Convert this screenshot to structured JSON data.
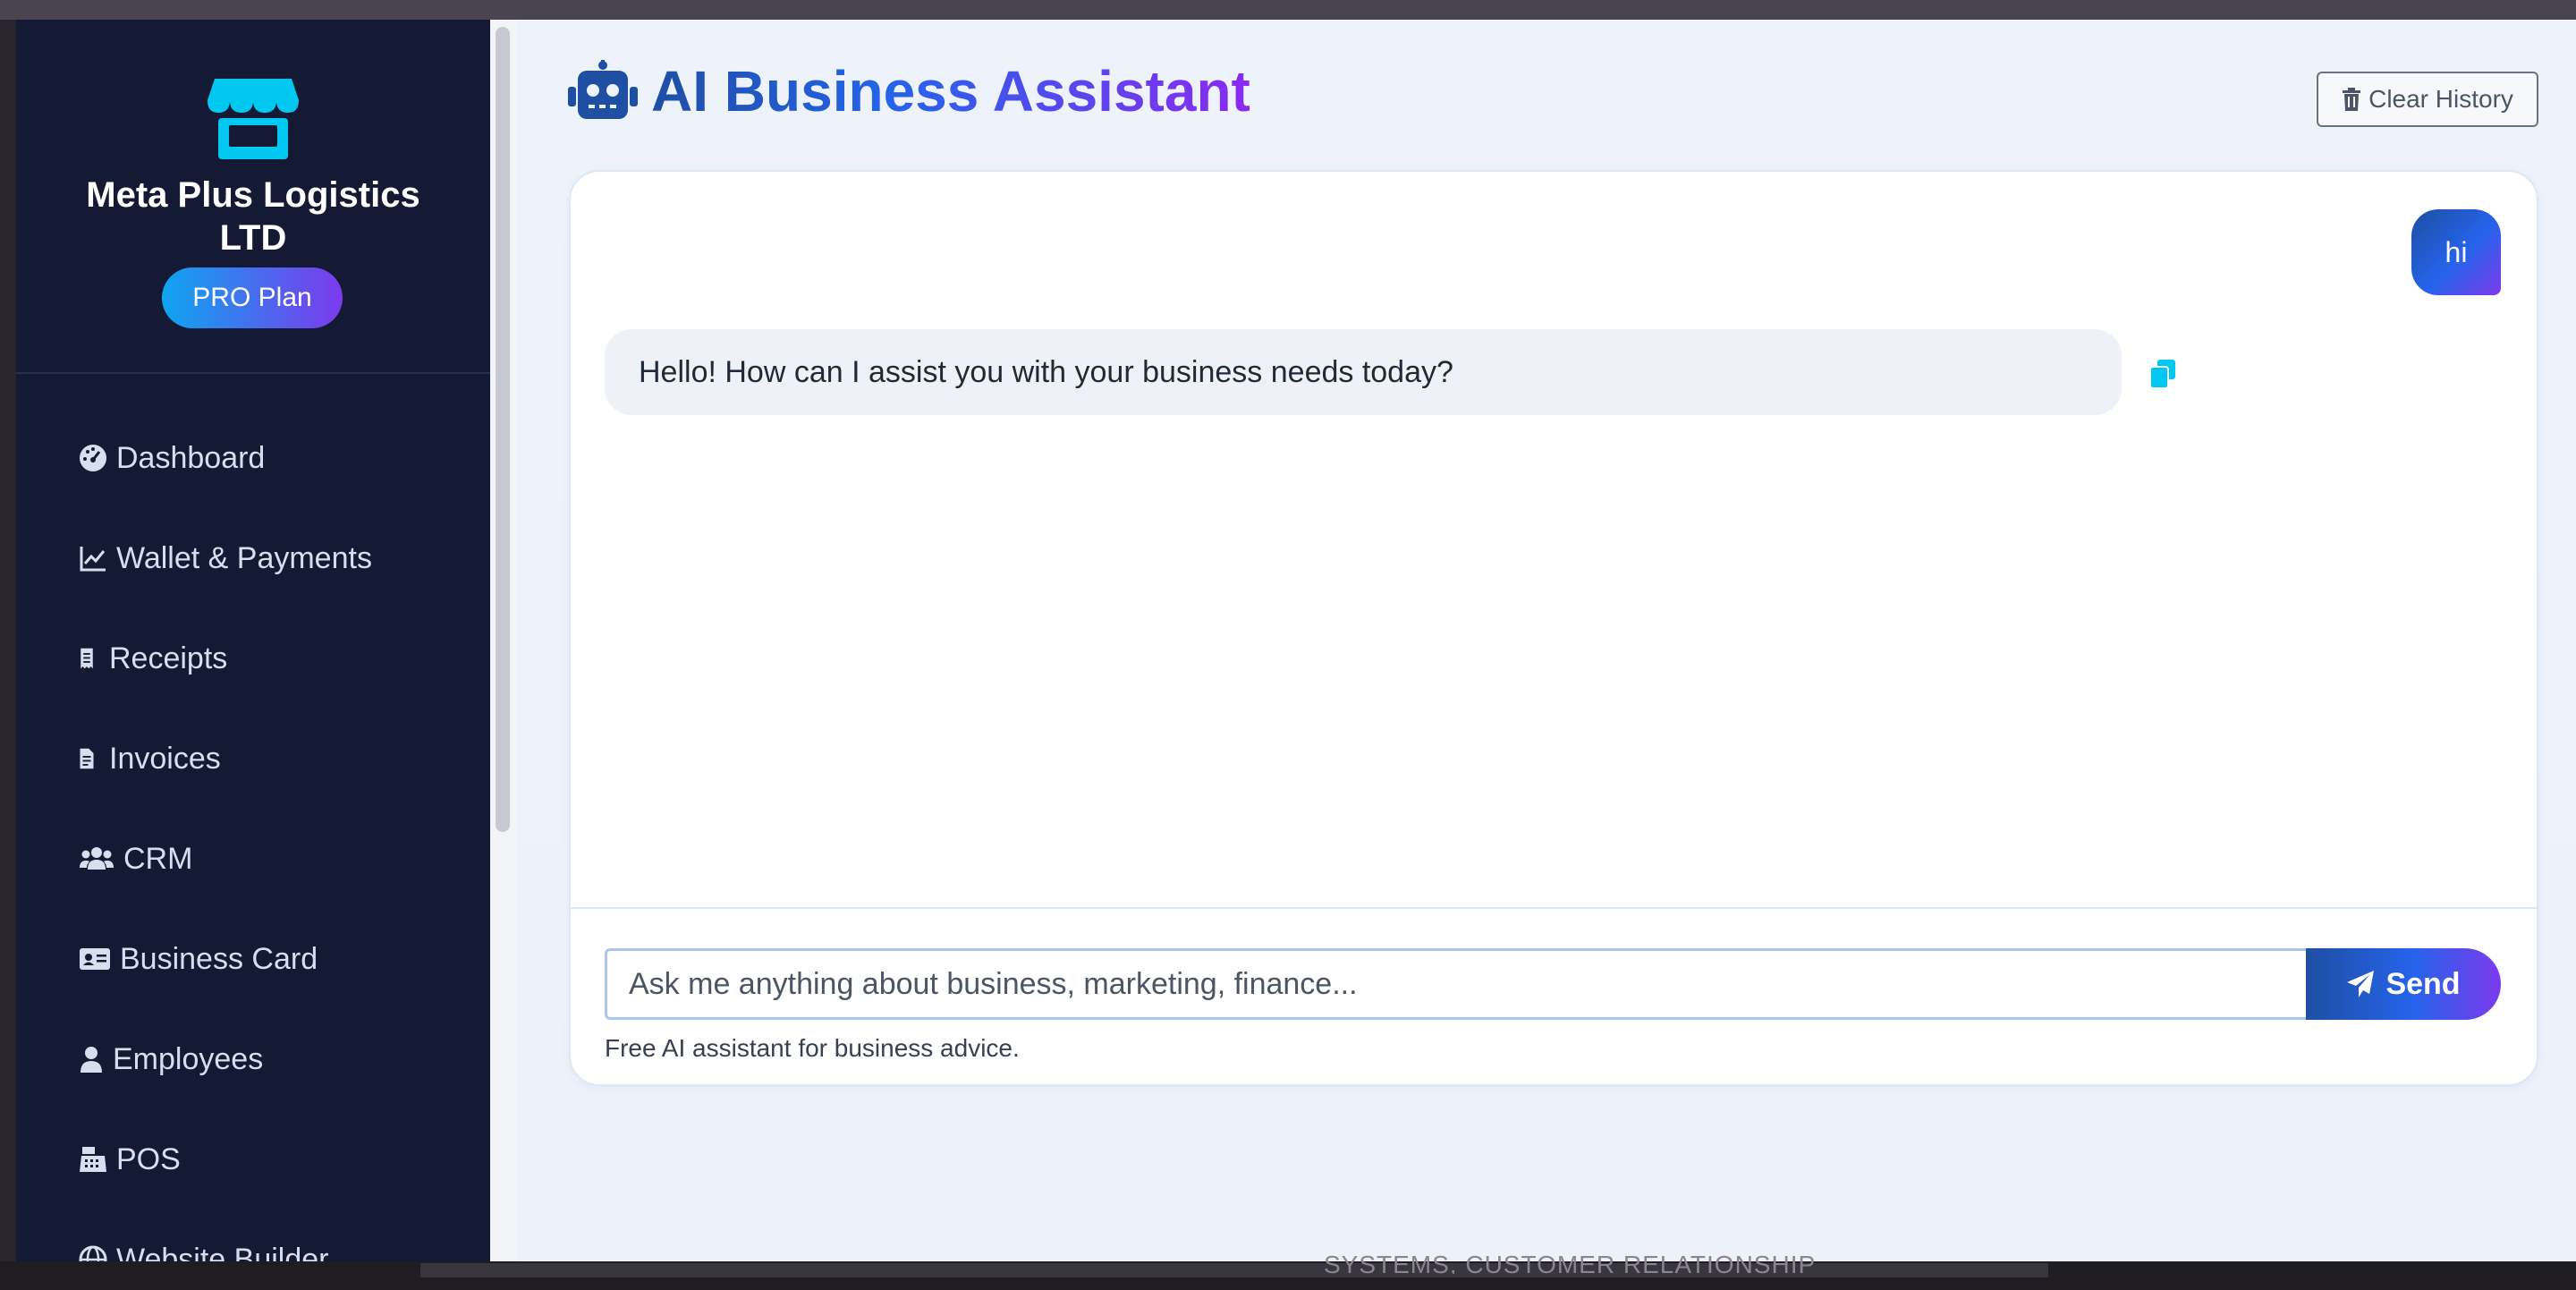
{
  "brand": {
    "name_line1": "Meta Plus Logistics",
    "name_line2": "LTD",
    "plan": "PRO Plan",
    "icon": "storefront-icon"
  },
  "sidebar": {
    "items": [
      {
        "label": "Dashboard",
        "icon": "gauge-icon"
      },
      {
        "label": "Wallet & Payments",
        "icon": "chart-line-icon"
      },
      {
        "label": "Receipts",
        "icon": "receipt-icon"
      },
      {
        "label": "Invoices",
        "icon": "file-invoice-icon"
      },
      {
        "label": "CRM",
        "icon": "users-icon"
      },
      {
        "label": "Business Card",
        "icon": "id-card-icon"
      },
      {
        "label": "Employees",
        "icon": "user-icon"
      },
      {
        "label": "POS",
        "icon": "cash-register-icon"
      },
      {
        "label": "Website Builder",
        "icon": "globe-icon"
      }
    ]
  },
  "header": {
    "title": "AI Business Assistant",
    "icon": "robot-icon",
    "clear_label": "Clear History"
  },
  "chat": {
    "messages": [
      {
        "role": "user",
        "text": "hi"
      },
      {
        "role": "assistant",
        "text": "Hello! How can I assist you with your business needs today?"
      }
    ],
    "input_placeholder": "Ask me anything about business, marketing, finance...",
    "send_label": "Send",
    "hint": "Free AI assistant for business advice."
  },
  "background": {
    "behind_text": "SYSTEMS, CUSTOMER RELATIONSHIP"
  },
  "colors": {
    "sidebar_bg": "#141a33",
    "accent_blue": "#2563eb",
    "accent_purple": "#7c3aed",
    "cyan": "#00c8f0"
  }
}
